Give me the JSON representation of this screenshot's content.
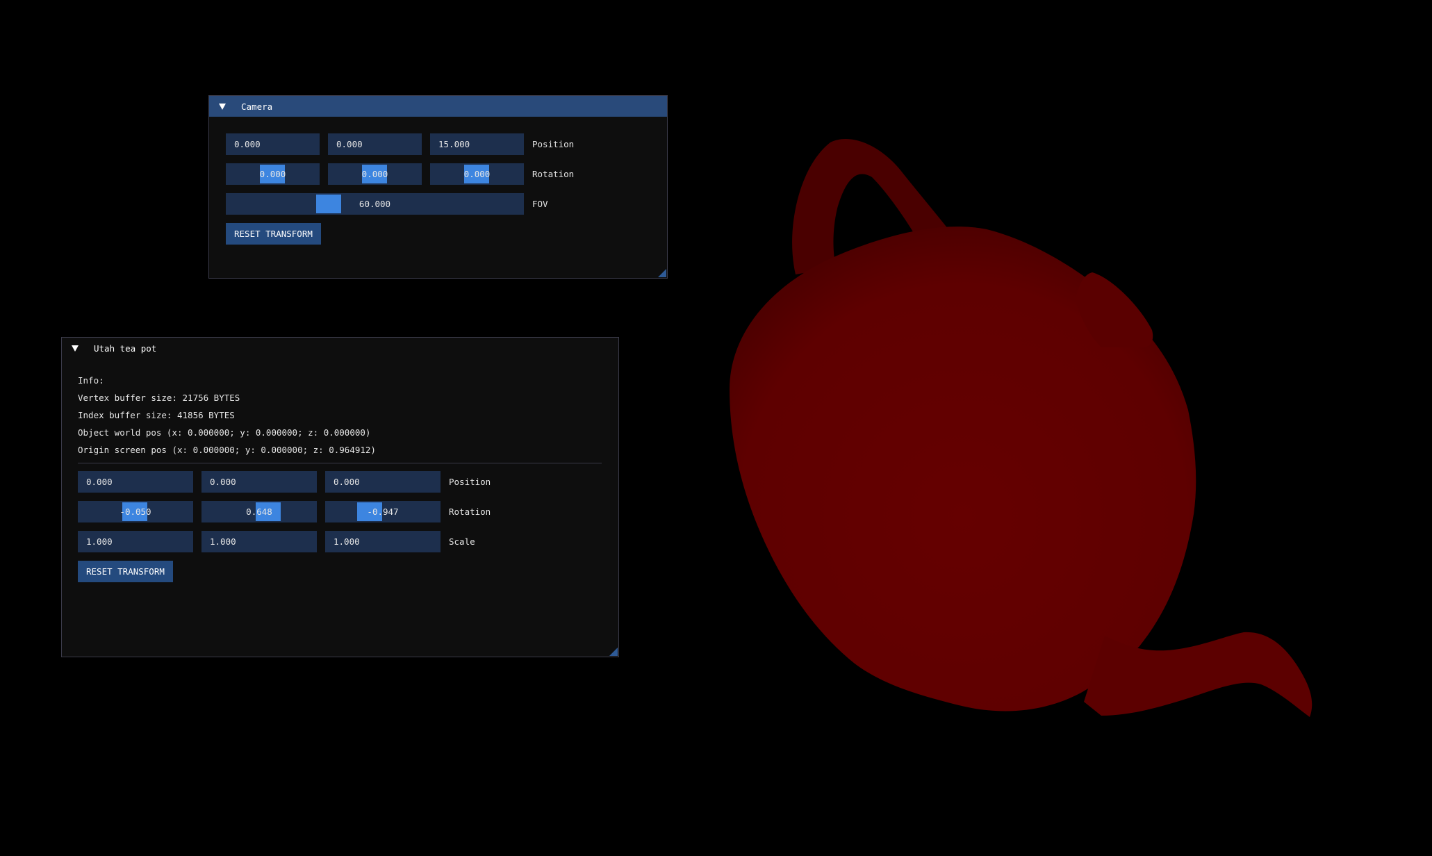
{
  "colors": {
    "background": "#000000",
    "window_bg": "#0f0f0f",
    "title_active": "#294a7a",
    "field_bg": "#1d2f4d",
    "slider_grab": "#3d85e0",
    "button_bg": "#244a7e",
    "teapot": "#620000"
  },
  "camera": {
    "title": "Camera",
    "position": {
      "label": "Position",
      "x": "0.000",
      "y": "0.000",
      "z": "15.000"
    },
    "rotation": {
      "label": "Rotation",
      "x": "0.000",
      "y": "0.000",
      "z": "0.000"
    },
    "fov": {
      "label": "FOV",
      "value": "60.000",
      "level": 0.33
    },
    "reset_label": "RESET TRANSFORM"
  },
  "teapot": {
    "title": "Utah tea pot",
    "info": {
      "heading": "Info:",
      "vertex_buffer": "Vertex buffer size: 21756 BYTES",
      "index_buffer": "Index buffer size: 41856 BYTES",
      "world_pos": "Object world pos (x: 0.000000; y: 0.000000; z: 0.000000)",
      "screen_pos": "Origin screen pos (x: 0.000000; y: 0.000000; z: 0.964912)"
    },
    "position": {
      "label": "Position",
      "x": "0.000",
      "y": "0.000",
      "z": "0.000"
    },
    "rotation": {
      "label": "Rotation",
      "x": "-0.050",
      "y": "0.648",
      "z": "-0.947"
    },
    "scale": {
      "label": "Scale",
      "x": "1.000",
      "y": "1.000",
      "z": "1.000"
    },
    "reset_label": "RESET TRANSFORM"
  }
}
